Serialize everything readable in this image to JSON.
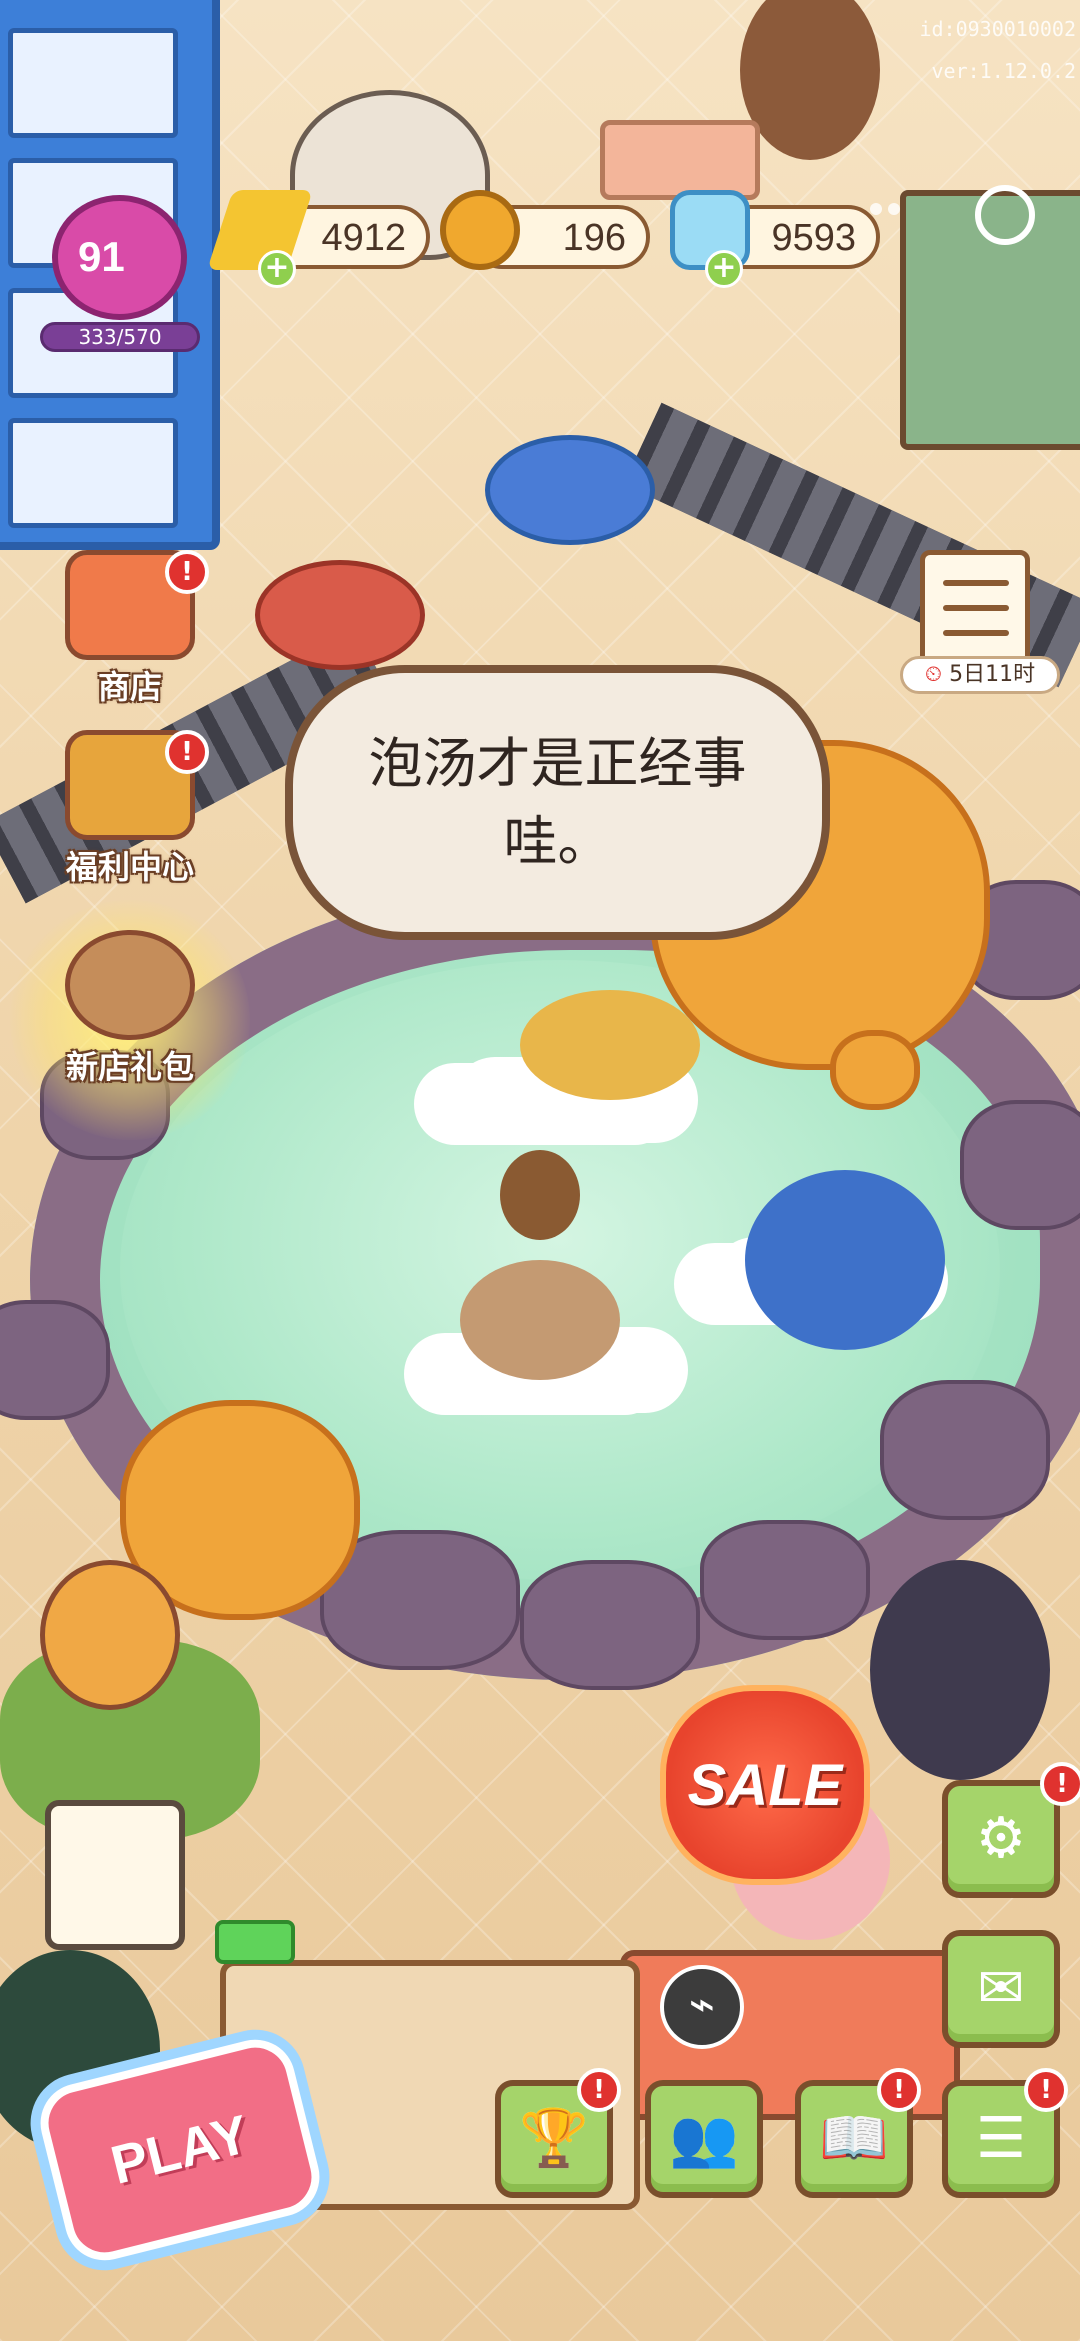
{
  "debug": {
    "id": "id:0930010002",
    "version": "ver:1.12.0.2"
  },
  "player": {
    "level": "91",
    "xp": "333/570"
  },
  "resources": [
    {
      "name": "energy",
      "icon": "lightning-icon",
      "value": "4912",
      "color": "#f4c531"
    },
    {
      "name": "coins",
      "icon": "coin-icon",
      "value": "196",
      "color": "#f0a82e"
    },
    {
      "name": "gems",
      "icon": "gem-icon",
      "value": "9593",
      "color": "#9bdcf5"
    }
  ],
  "left_menu": [
    {
      "label": "商店",
      "icon": "shop-icon",
      "badge": "!"
    },
    {
      "label": "福利中心",
      "icon": "treasure-chest-icon",
      "badge": "!"
    },
    {
      "label": "新店礼包",
      "icon": "gift-pack-icon",
      "badge": ""
    }
  ],
  "task": {
    "timer": "5日11时",
    "badge_icon": "clock-icon"
  },
  "speech": {
    "text": "泡汤才是正经事哇。"
  },
  "sale": {
    "label": "SALE"
  },
  "play": {
    "label": "PLAY"
  },
  "bottom_bar": [
    {
      "name": "trophy",
      "icon": "trophy-icon",
      "glyph": "🏆",
      "badge": "!"
    },
    {
      "name": "friends",
      "icon": "friends-icon",
      "glyph": "👥",
      "badge": ""
    },
    {
      "name": "book",
      "icon": "book-icon",
      "glyph": "📖",
      "badge": "!"
    },
    {
      "name": "list",
      "icon": "list-icon",
      "glyph": "☰",
      "badge": "!"
    }
  ],
  "right_bar": [
    {
      "name": "settings",
      "icon": "gear-icon",
      "glyph": "⚙",
      "badge": "!"
    },
    {
      "name": "mail",
      "icon": "mail-icon",
      "glyph": "✉",
      "badge": ""
    }
  ],
  "badge_symbol": "!"
}
